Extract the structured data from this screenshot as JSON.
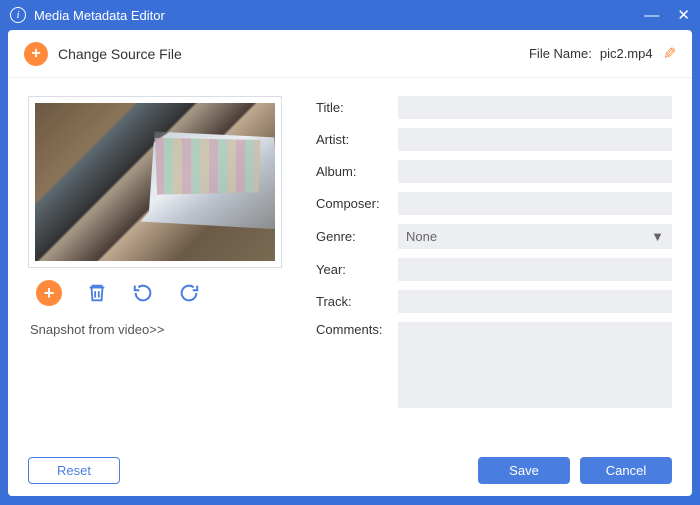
{
  "titlebar": {
    "title": "Media Metadata Editor"
  },
  "topbar": {
    "change_source": "Change Source File",
    "file_name_label": "File Name:",
    "file_name_value": "pic2.mp4"
  },
  "left": {
    "snapshot_link": "Snapshot from video>>"
  },
  "fields": {
    "title_label": "Title:",
    "title_value": "",
    "artist_label": "Artist:",
    "artist_value": "",
    "album_label": "Album:",
    "album_value": "",
    "composer_label": "Composer:",
    "composer_value": "",
    "genre_label": "Genre:",
    "genre_value": "None",
    "year_label": "Year:",
    "year_value": "",
    "track_label": "Track:",
    "track_value": "",
    "comments_label": "Comments:",
    "comments_value": ""
  },
  "footer": {
    "reset": "Reset",
    "save": "Save",
    "cancel": "Cancel"
  }
}
